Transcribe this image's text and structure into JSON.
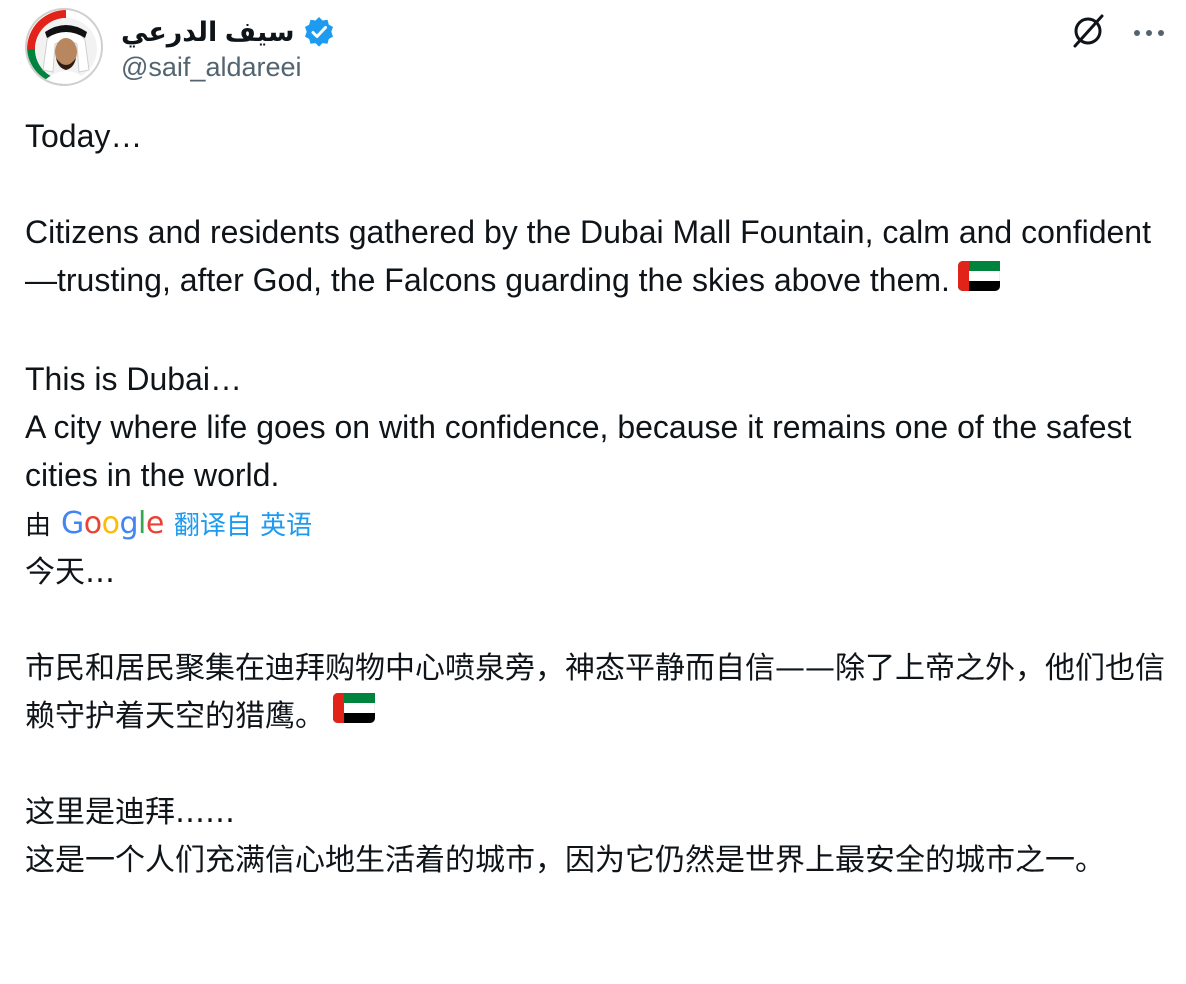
{
  "author": {
    "display_name": "سيف الدرعي",
    "handle": "@saif_aldareei",
    "verified": true,
    "badge_color": "#1d9bf0"
  },
  "header_icons": [
    "grok-icon",
    "more-icon"
  ],
  "original_text": {
    "line1": "Today…",
    "para2": "Citizens and residents gathered by the Dubai Mall Fountain, calm and confident—trusting, after God, the Falcons guarding the skies above them.",
    "line3": "This is Dubai…",
    "para4": "A city where life goes on with confidence, because it remains one of the safest cities in the world."
  },
  "translation": {
    "by_label": "由",
    "brand": "Google",
    "link_label": "翻译自 英语",
    "link_color": "#1d9bf0",
    "line1": "今天…",
    "para2": "市民和居民聚集在迪拜购物中心喷泉旁，神态平静而自信——除了上帝之外，他们也信赖守护着天空的猎鹰。",
    "line3": "这里是迪拜……",
    "para4": "这是一个人们充满信心地生活着的城市，因为它仍然是世界上最安全的城市之一。"
  },
  "flag_colors": {
    "red": "#e2231a",
    "green": "#00843d",
    "white": "#ffffff",
    "black": "#000000"
  },
  "google_colors": [
    "#4285f4",
    "#ea4335",
    "#fbbc05",
    "#4285f4",
    "#34a853",
    "#ea4335"
  ]
}
